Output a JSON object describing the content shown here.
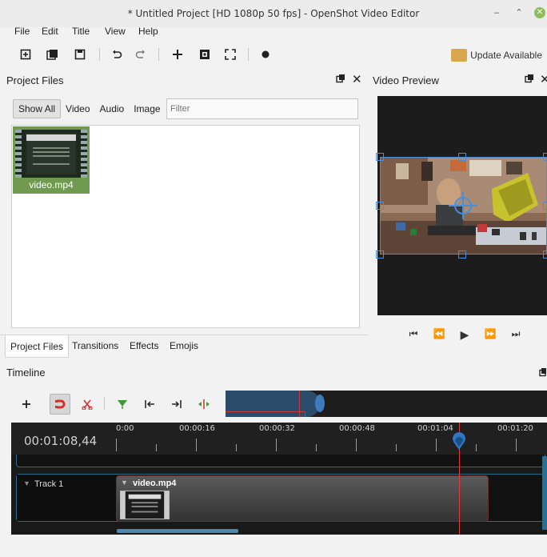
{
  "window": {
    "title": "* Untitled Project [HD 1080p 50 fps] - OpenShot Video Editor",
    "minimize": "–",
    "maximize": "⌃",
    "close": "✕"
  },
  "menu": [
    "File",
    "Edit",
    "Title",
    "View",
    "Help"
  ],
  "toolbar": {
    "update_label": "Update Available"
  },
  "project_files": {
    "title": "Project Files",
    "filters": [
      "Show All",
      "Video",
      "Audio",
      "Image"
    ],
    "active_filter": "Show All",
    "filter_placeholder": "Filter",
    "files": [
      {
        "name": "video.mp4"
      }
    ]
  },
  "video_preview": {
    "title": "Video Preview"
  },
  "bottom_tabs": [
    "Project Files",
    "Transitions",
    "Effects",
    "Emojis"
  ],
  "timeline": {
    "title": "Timeline",
    "current_time": "00:01:08,44",
    "ticks": [
      "0:00",
      "00:00:16",
      "00:00:32",
      "00:00:48",
      "00:01:04",
      "00:01:20"
    ],
    "tracks": [
      {
        "name": "Track 1",
        "clip": "video.mp4"
      }
    ]
  },
  "colors": {
    "accent": "#3d7bbd",
    "playhead": "#e23b3b",
    "clip_thumb_bg": "#6f9a4f"
  }
}
